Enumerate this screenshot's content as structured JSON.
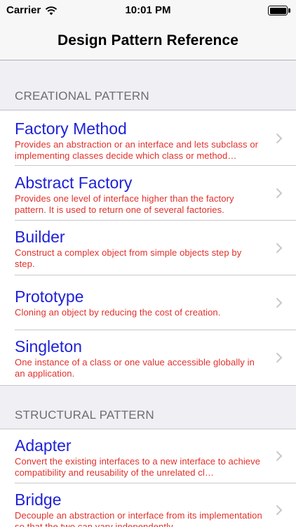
{
  "status_bar": {
    "carrier": "Carrier",
    "time": "10:01 PM"
  },
  "nav": {
    "title": "Design Pattern Reference"
  },
  "sections": [
    {
      "header": "CREATIONAL PATTERN",
      "items": [
        {
          "title": "Factory Method",
          "subtitle": "Provides an abstraction or an interface and lets subclass or implementing classes decide which class or method…"
        },
        {
          "title": "Abstract Factory",
          "subtitle": "Provides one level of interface higher than the factory pattern. It is used to return one of several factories."
        },
        {
          "title": "Builder",
          "subtitle": "Construct a complex object from simple objects step by step."
        },
        {
          "title": "Prototype",
          "subtitle": "Cloning an object by reducing the cost of creation."
        },
        {
          "title": "Singleton",
          "subtitle": "One instance of a class or one value accessible globally in an application."
        }
      ]
    },
    {
      "header": "STRUCTURAL PATTERN",
      "items": [
        {
          "title": "Adapter",
          "subtitle": "Convert the existing interfaces to a new interface to achieve compatibility and reusability of the unrelated cl…"
        },
        {
          "title": "Bridge",
          "subtitle": "Decouple an abstraction or interface from its implementation so that the two can vary independently."
        }
      ]
    }
  ],
  "colors": {
    "title": "#1f22d6",
    "subtitle": "#e0302b",
    "section_header_text": "#6d6d72",
    "background": "#efeff4",
    "chevron": "#c7c7cc"
  },
  "icons": {
    "wifi": "wifi-icon",
    "battery": "battery-icon",
    "chevron": "chevron-right-icon"
  }
}
